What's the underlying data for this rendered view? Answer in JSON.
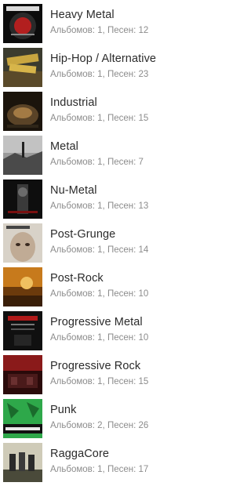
{
  "genres": [
    {
      "title": "Heavy Metal",
      "meta": "Альбомов: 1, Песен: 12",
      "art": "heavy-metal-cover-art"
    },
    {
      "title": "Hip-Hop / Alternative",
      "meta": "Альбомов: 1, Песен: 23",
      "art": "hip-hop-cover-art"
    },
    {
      "title": "Industrial",
      "meta": "Альбомов: 1, Песен: 15",
      "art": "industrial-cover-art"
    },
    {
      "title": "Metal",
      "meta": "Альбомов: 1, Песен: 7",
      "art": "metal-cover-art"
    },
    {
      "title": "Nu-Metal",
      "meta": "Альбомов: 1, Песен: 13",
      "art": "nu-metal-cover-art"
    },
    {
      "title": "Post-Grunge",
      "meta": "Альбомов: 1, Песен: 14",
      "art": "post-grunge-cover-art"
    },
    {
      "title": "Post-Rock",
      "meta": "Альбомов: 1, Песен: 10",
      "art": "post-rock-cover-art"
    },
    {
      "title": "Progressive Metal",
      "meta": "Альбомов: 1, Песен: 10",
      "art": "progressive-metal-cover-art"
    },
    {
      "title": "Progressive Rock",
      "meta": "Альбомов: 1, Песен: 15",
      "art": "progressive-rock-cover-art"
    },
    {
      "title": "Punk",
      "meta": "Альбомов: 2, Песен: 26",
      "art": "punk-cover-art"
    },
    {
      "title": "RaggaCore",
      "meta": "Альбомов: 1, Песен: 17",
      "art": "raggacore-cover-art"
    }
  ],
  "colors": {
    "title_text": "#2b2b2b",
    "meta_text": "#8c8c8c",
    "background": "#ffffff"
  }
}
